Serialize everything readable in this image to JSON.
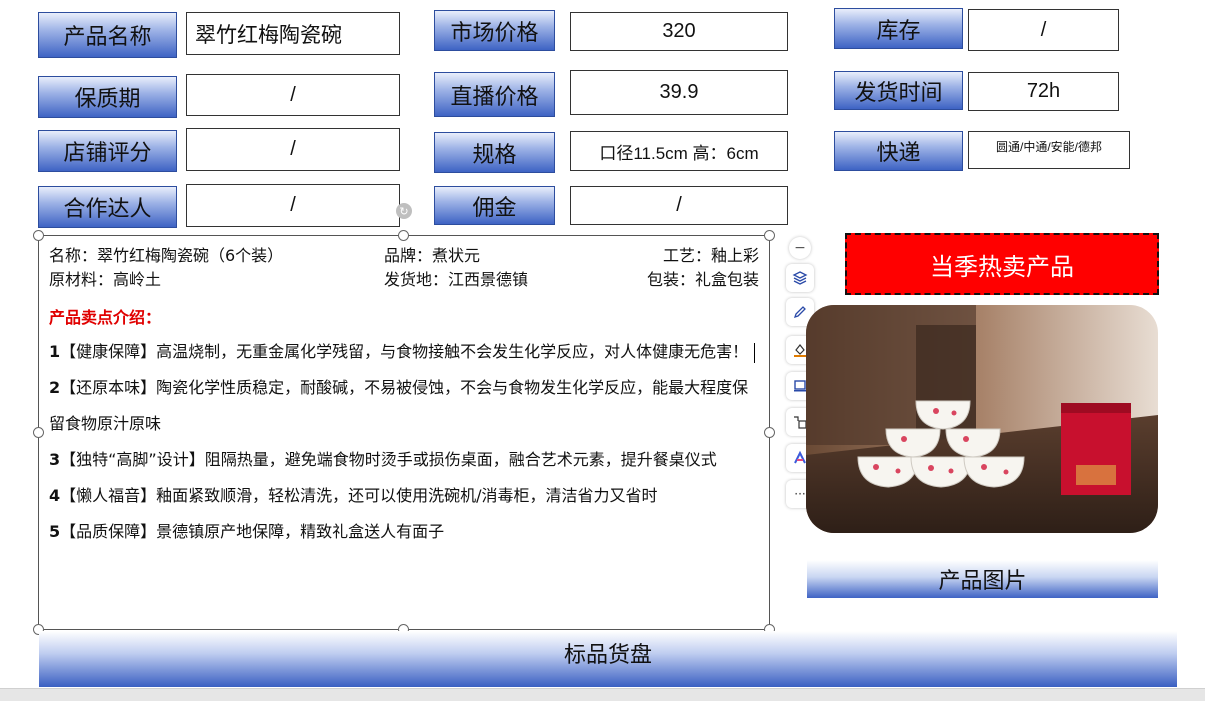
{
  "fields": {
    "name_label": "产品名称",
    "name_value": "翠竹红梅陶瓷碗",
    "market_price_label": "市场价格",
    "market_price_value": "320",
    "stock_label": "库存",
    "stock_value": "/",
    "shelf_life_label": "保质期",
    "shelf_life_value": "/",
    "live_price_label": "直播价格",
    "live_price_value": "39.9",
    "ship_time_label": "发货时间",
    "ship_time_value": "72h",
    "rating_label": "店铺评分",
    "rating_value": "/",
    "spec_label": "规格",
    "spec_value": "口径11.5cm  高：6cm",
    "courier_label": "快递",
    "courier_value": "圆通/中通/安能/德邦",
    "partner_label": "合作达人",
    "partner_value": "/",
    "commission_label": "佣金",
    "commission_value": "/"
  },
  "details": {
    "name": "名称：翠竹红梅陶瓷碗（6个装）",
    "brand": "品牌：煮状元",
    "craft": "工艺：釉上彩",
    "material": "原材料：高岭土",
    "origin": "发货地：江西景德镇",
    "packaging": "包装：礼盒包装",
    "selling_title": "产品卖点介绍：",
    "points": [
      {
        "num": "1",
        "text": "【健康保障】高温烧制，无重金属化学残留，与食物接触不会发生化学反应，对人体健康无危害！"
      },
      {
        "num": "2",
        "text": "【还原本味】陶瓷化学性质稳定，耐酸碱，不易被侵蚀，不会与食物发生化学反应，能最大程度保留食物原汁原味"
      },
      {
        "num": "3",
        "text": "【独特“高脚”设计】阻隔热量，避免端食物时烫手或损伤桌面，融合艺术元素，提升餐桌仪式"
      },
      {
        "num": "4",
        "text": "【懒人福音】釉面紧致顺滑，轻松清洗，还可以使用洗碗机/消毒柜，清洁省力又省时"
      },
      {
        "num": "5",
        "text": "【品质保障】景德镇原产地保障，精致礼盒送人有面子"
      }
    ]
  },
  "toolbar": {
    "icons": [
      "minus-icon",
      "layers-icon",
      "pen-icon",
      "fill-icon",
      "frame-icon",
      "replace-icon",
      "ai-icon",
      "more-icon"
    ],
    "more_label": "···"
  },
  "hot_label": "当季热卖产品",
  "photo_caption": "产品图片",
  "footer_label": "标品货盘"
}
